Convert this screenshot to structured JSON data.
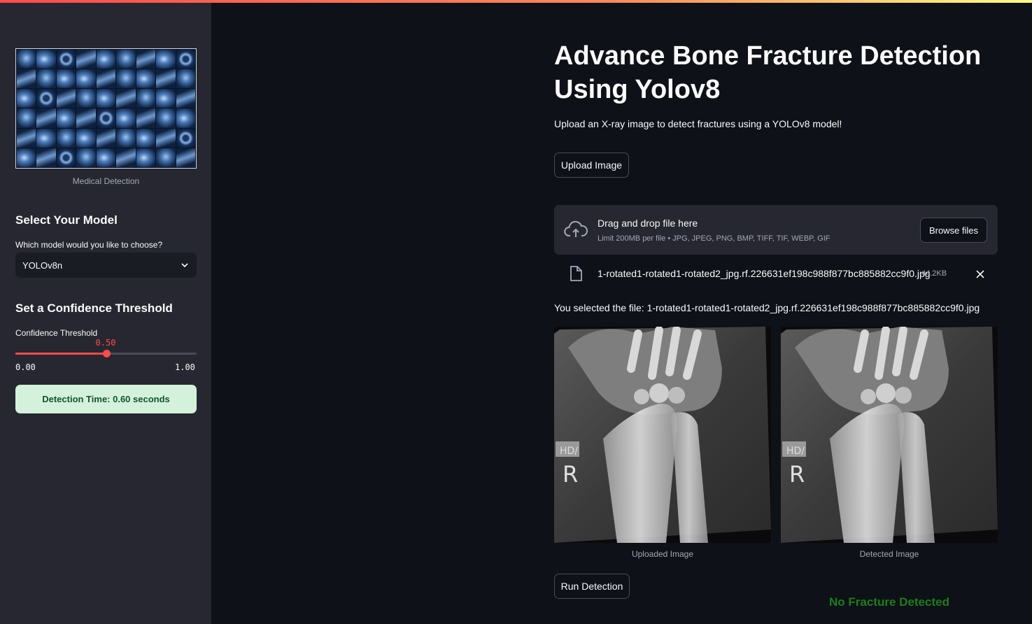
{
  "sidebar": {
    "image_caption": "Medical Detection",
    "model_heading": "Select Your Model",
    "model_question": "Which model would you like to choose?",
    "model_selected": "YOLOv8n",
    "confidence_heading": "Set a Confidence Threshold",
    "confidence_label": "Confidence Threshold",
    "confidence_value": "0.50",
    "confidence_fraction": 0.5,
    "confidence_min": "0.00",
    "confidence_max": "1.00",
    "detection_time": "Detection Time: 0.60 seconds"
  },
  "main": {
    "title": "Advance Bone Fracture Detection Using Yolov8",
    "subtitle": "Upload an X-ray image to detect fractures using a YOLOv8 model!",
    "upload_button": "Upload Image",
    "dropzone": {
      "title": "Drag and drop file here",
      "limit": "Limit 200MB per file • JPG, JPEG, PNG, BMP, TIFF, TIF, WEBP, GIF",
      "browse_button": "Browse files"
    },
    "file": {
      "name": "1-rotated1-rotated1-rotated2_jpg.rf.226631ef198c988f877bc885882cc9f0.jpg",
      "size": "44.2KB"
    },
    "selected_text": "You selected the file: 1-rotated1-rotated1-rotated2_jpg.rf.226631ef198c988f877bc885882cc9f0.jpg",
    "uploaded_caption": "Uploaded Image",
    "detected_caption": "Detected Image",
    "run_button": "Run Detection",
    "result": "No Fracture Detected"
  },
  "colors": {
    "accent": "#ff4b4b",
    "success_bg": "#d4f2db",
    "result_green": "#1a7f1a"
  },
  "icons": [
    "chevron-down-icon",
    "cloud-upload-icon",
    "file-icon",
    "close-icon"
  ]
}
